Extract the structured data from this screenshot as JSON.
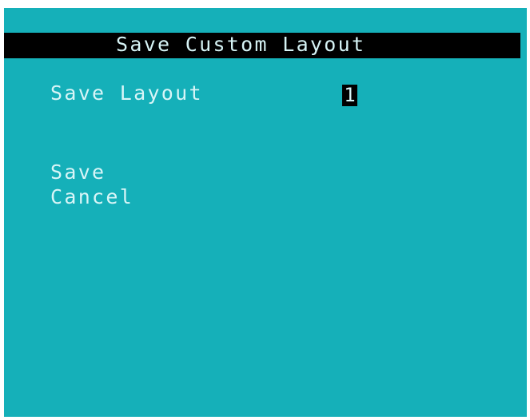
{
  "title": "Save Custom Layout",
  "form": {
    "save_layout_label": "Save Layout",
    "save_layout_value": "1"
  },
  "menu": {
    "save_label": "Save",
    "cancel_label": "Cancel"
  },
  "colors": {
    "background": "#15b0b9",
    "title_bar": "#000000",
    "text": "#d8f5f7"
  }
}
